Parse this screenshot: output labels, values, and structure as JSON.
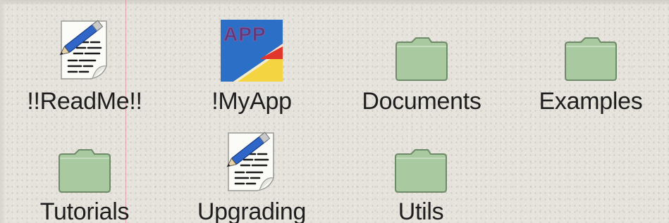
{
  "filer": {
    "items": [
      {
        "label": "!!ReadMe!!",
        "icon": "text-document-icon"
      },
      {
        "label": "!MyApp",
        "icon": "app-icon"
      },
      {
        "label": "Documents",
        "icon": "folder-icon"
      },
      {
        "label": "Examples",
        "icon": "folder-icon"
      },
      {
        "label": "Tutorials",
        "icon": "folder-icon"
      },
      {
        "label": "Upgrading",
        "icon": "text-document-icon"
      },
      {
        "label": "Utils",
        "icon": "folder-icon"
      }
    ],
    "app_icon_text": "APP"
  },
  "colors": {
    "folder_fill": "#a9c9a0",
    "folder_stroke": "#6e8a68",
    "app_blue": "#2c6fc6",
    "app_yellow": "#f4d441",
    "app_red": "#e0362c",
    "background": "#e5e3db"
  }
}
